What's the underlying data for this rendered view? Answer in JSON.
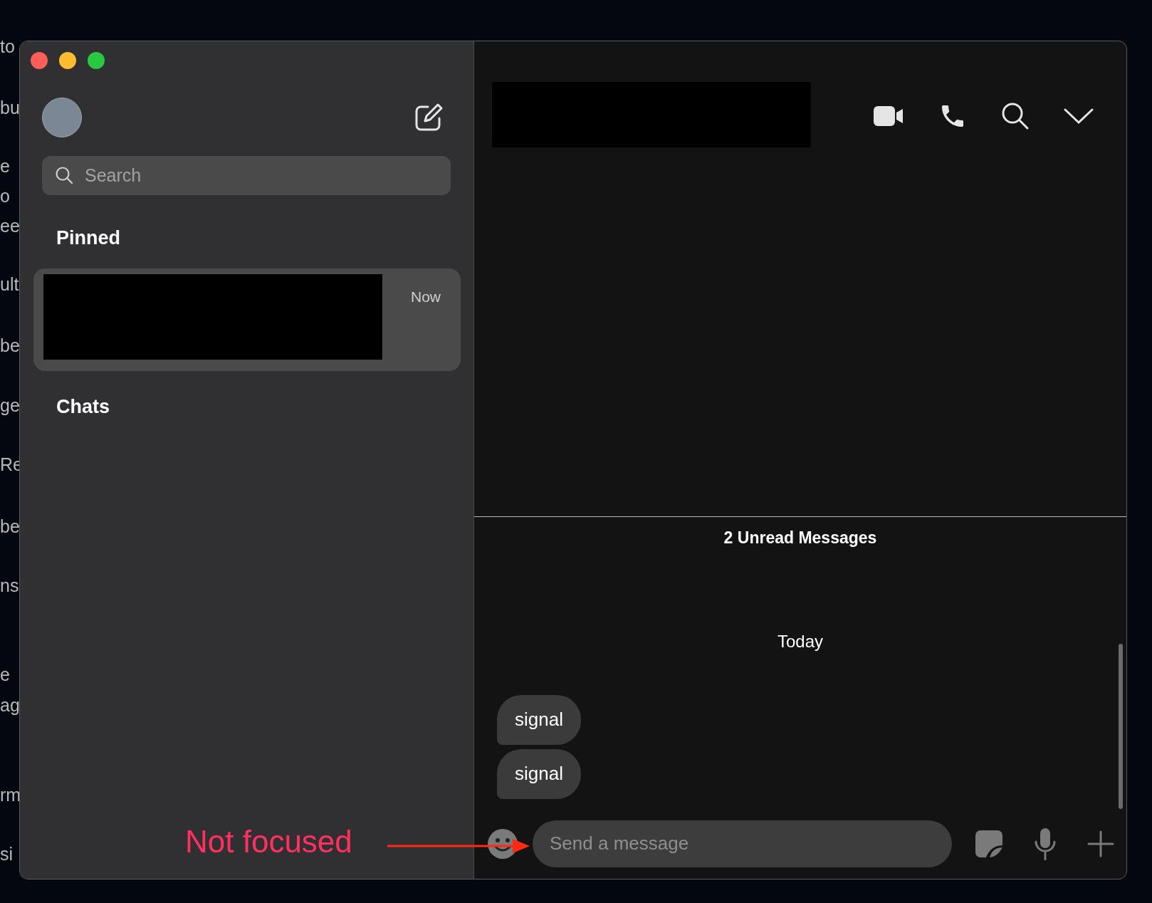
{
  "background_text": [
    "to",
    "bu",
    "e",
    "o",
    "ee",
    "ult",
    "be",
    "ge",
    "Re",
    "be",
    "ns",
    "e",
    "ag",
    "rm",
    "si"
  ],
  "sidebar": {
    "search": {
      "placeholder": "Search"
    },
    "sections": [
      {
        "title": "Pinned",
        "items": [
          {
            "time": "Now",
            "selected": true
          }
        ]
      },
      {
        "title": "Chats"
      }
    ]
  },
  "chat": {
    "unread_divider": "2 Unread Messages",
    "date": "Today",
    "messages": [
      {
        "text": "signal"
      },
      {
        "text": "signal"
      }
    ],
    "composer": {
      "placeholder": "Send a message"
    }
  },
  "annotation": {
    "text": "Not focused"
  }
}
